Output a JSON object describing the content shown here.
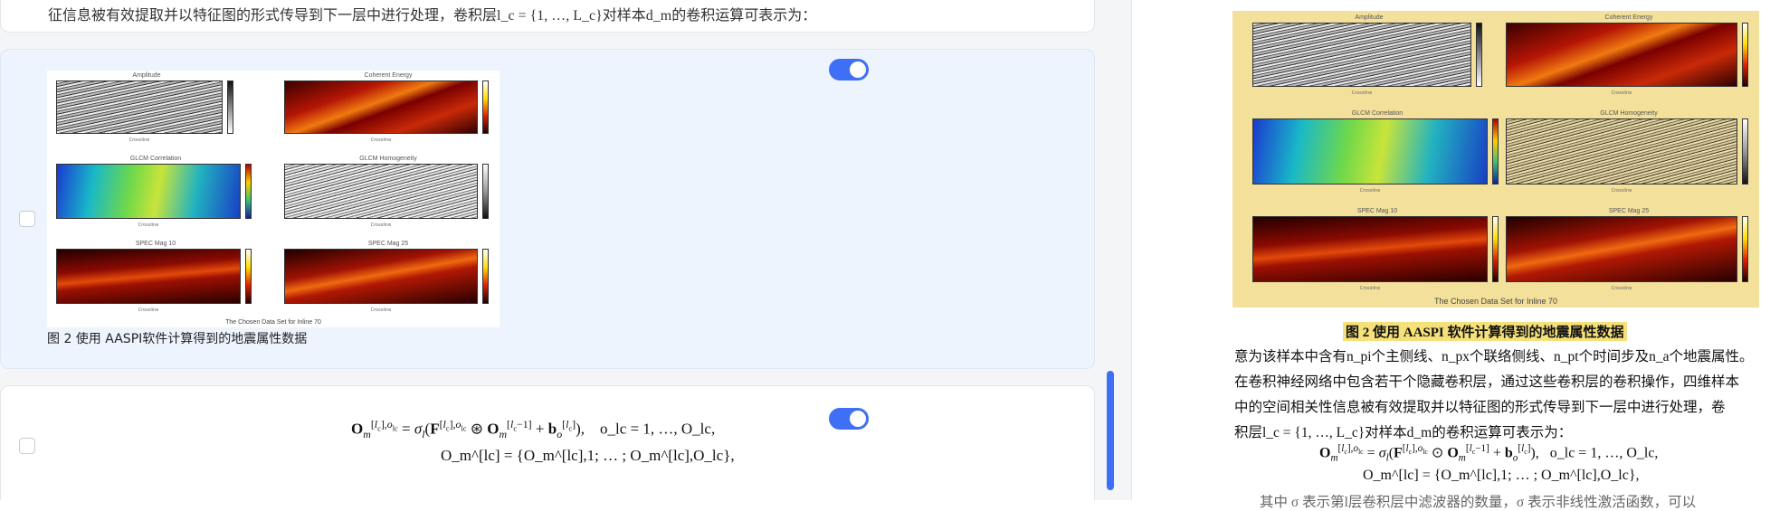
{
  "top_card": {
    "text": "征信息被有效提取并以特征图的形式传导到下一层中进行处理，卷积层l_c = {1, …, L_c}对样本d_m的卷积运算可表示为："
  },
  "figure_card": {
    "caption": "图 2 使用 AASPI软件计算得到的地震属性数据",
    "panels": [
      {
        "title": "Amplitude",
        "xlabel": "Crossline"
      },
      {
        "title": "Coherent Energy",
        "xlabel": "Crossline"
      },
      {
        "title": "GLCM Correlation",
        "xlabel": "Crossline"
      },
      {
        "title": "GLCM Homogeneity",
        "xlabel": "Crossline"
      },
      {
        "title": "SPEC Mag 10",
        "xlabel": "Crossline"
      },
      {
        "title": "SPEC Mag 25",
        "xlabel": "Crossline"
      }
    ],
    "footer": "The Chosen Data Set for Inline 70",
    "toggle_on": true
  },
  "formula_card": {
    "toggle_on": true,
    "eq1_range": "o_lc = 1, …, O_lc,",
    "eq2": "O_m^[lc] = {O_m^[lc],1; … ; O_m^[lc],O_lc},"
  },
  "right_doc": {
    "caption": "图 2  使用 AASPI 软件计算得到的地震属性数据",
    "lines": [
      "意为该样本中含有n_pi个主侧线、n_px个联络侧线、n_pt个时间步及n_a个地震属性。",
      "在卷积神经网络中包含若干个隐藏卷积层，通过这些卷积层的卷积操作，四维样本",
      "中的空间相关性信息被有效提取并以特征图的形式传导到下一层中进行处理，卷",
      "积层l_c = {1, …, L_c}对样本d_m的卷积运算可表示为："
    ],
    "partial_line": "其中 σ 表示第l层卷积层中滤波器的数量，σ 表示非线性激活函数，可以"
  },
  "colors": {
    "accent": "#3f6ff5",
    "figure_card_bg": "#eef4fd",
    "caption_highlight": "#f5e07a",
    "image_border_bg": "#f3e09b"
  }
}
